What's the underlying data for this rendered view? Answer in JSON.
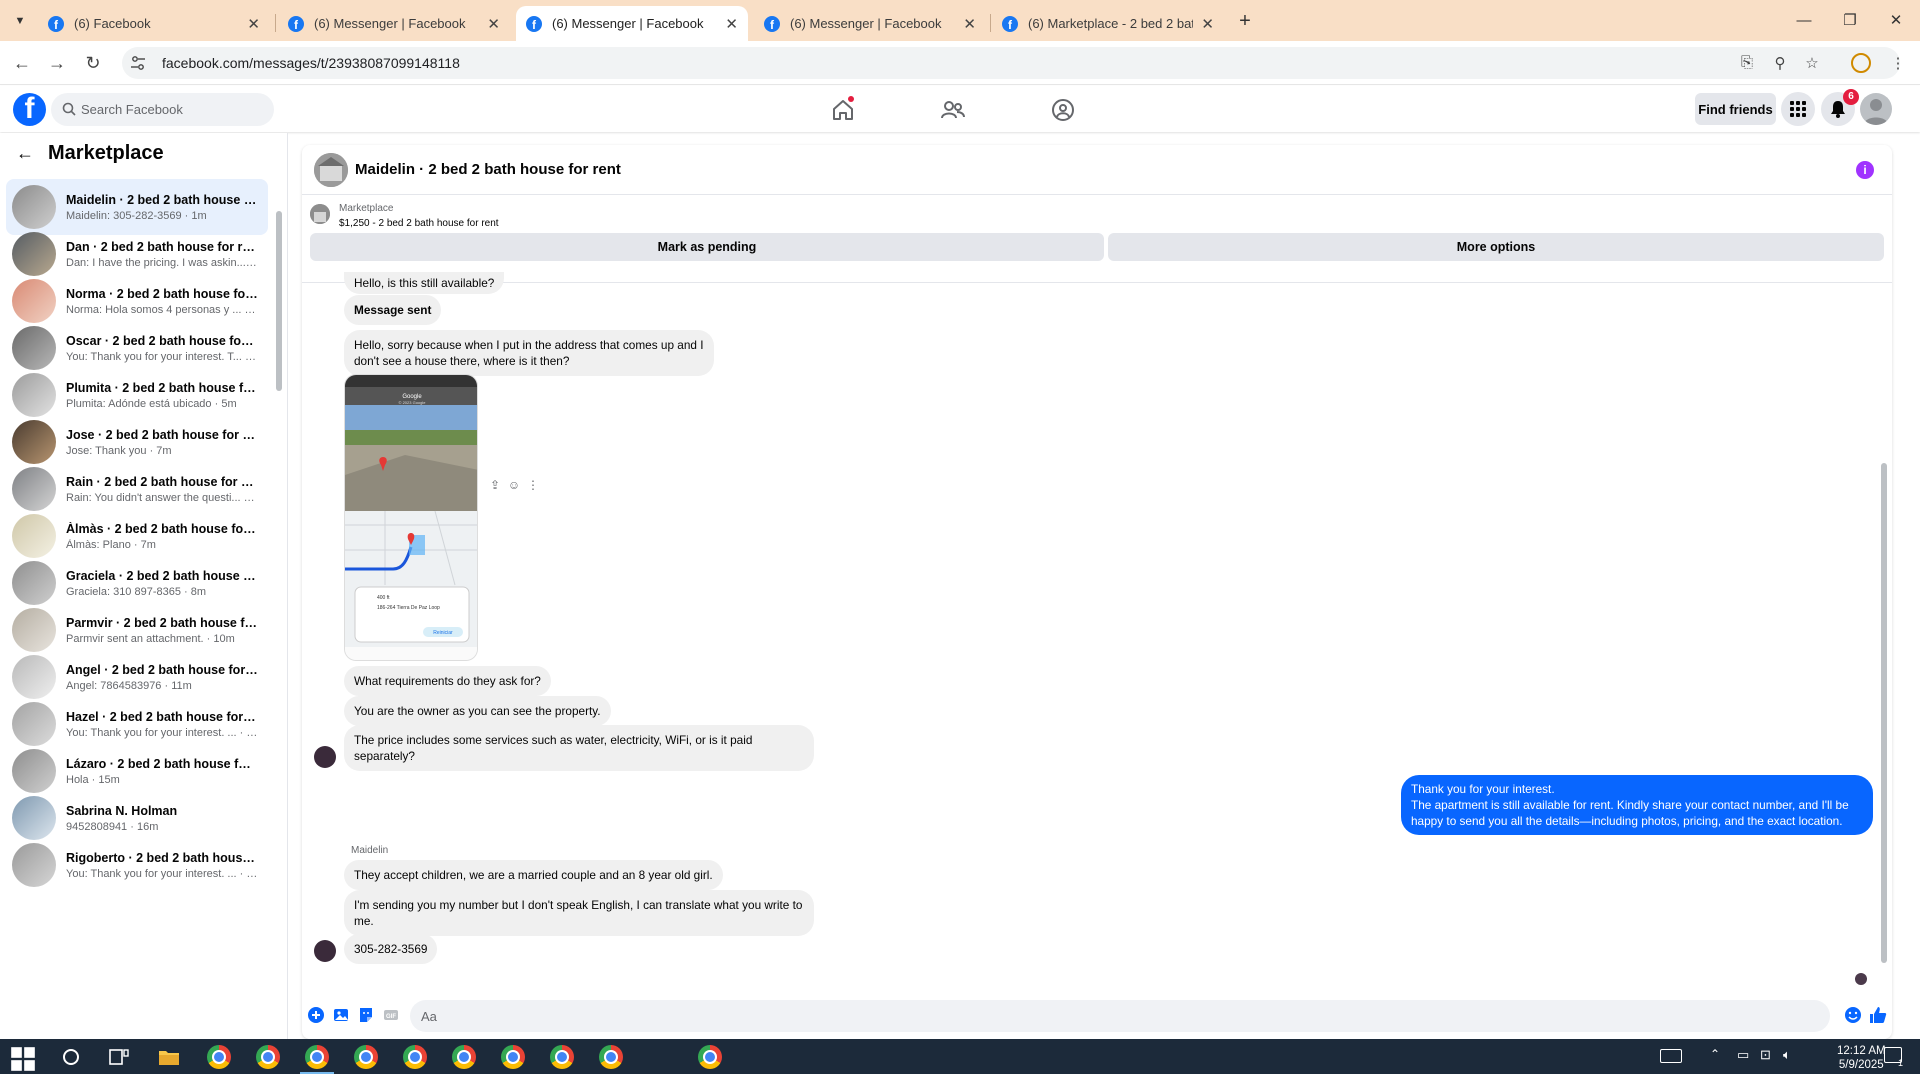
{
  "browser": {
    "tabs": [
      {
        "title": "(6) Facebook",
        "active": false
      },
      {
        "title": "(6) Messenger | Facebook",
        "active": false
      },
      {
        "title": "(6) Messenger | Facebook",
        "active": true
      },
      {
        "title": "(6) Messenger | Facebook",
        "active": false
      },
      {
        "title": "(6) Marketplace - 2 bed 2 bath h",
        "active": false
      }
    ],
    "url": "facebook.com/messages/t/23938087099148118"
  },
  "fb": {
    "search_placeholder": "Search Facebook",
    "find_friends_label": "Find friends",
    "notification_count": "6",
    "accent": "#0866ff"
  },
  "sidebar": {
    "title": "Marketplace",
    "conversations": [
      {
        "name": "Maidelin · 2 bed 2 bath house f...",
        "preview": "Maidelin: 305-282-3569 · 1m",
        "active": true
      },
      {
        "name": "Dan · 2 bed 2 bath house for rent",
        "preview": "Dan: I have the pricing. I was askin... · 1m"
      },
      {
        "name": "Norma · 2 bed 2 bath house for...",
        "preview": "Norma: Hola somos 4 personas y ... · 2m"
      },
      {
        "name": "Oscar · 2 bed 2 bath house for r...",
        "preview": "You: Thank you for your interest. T... · 2m"
      },
      {
        "name": "Plumita · 2 bed 2 bath house fo...",
        "preview": "Plumita: Adónde está ubicado · 5m"
      },
      {
        "name": "Jose · 2 bed 2 bath house for rent",
        "preview": "Jose: Thank you · 7m"
      },
      {
        "name": "Rain · 2 bed 2 bath house for rent",
        "preview": "Rain: You didn't answer the questi... · 7m"
      },
      {
        "name": "Àlmàs · 2 bed 2 bath house for ...",
        "preview": "Àlmàs: Plano · 7m"
      },
      {
        "name": "Graciela · 2 bed 2 bath house fo...",
        "preview": "Graciela: 310 897-8365 · 8m"
      },
      {
        "name": "Parmvir · 2 bed 2 bath house fo...",
        "preview": "Parmvir sent an attachment. · 10m"
      },
      {
        "name": "Angel · 2 bed 2 bath house for r...",
        "preview": "Angel: 7864583976 · 11m"
      },
      {
        "name": "Hazel · 2 bed 2 bath house for r...",
        "preview": "You: Thank you for your interest. ... · 14m"
      },
      {
        "name": "Lázaro · 2 bed 2 bath house for ...",
        "preview": "Hola · 15m"
      },
      {
        "name": "Sabrina N. Holman",
        "preview": "9452808941 · 16m"
      },
      {
        "name": "Rigoberto · 2 bed 2 bath house ...",
        "preview": "You: Thank you for your interest. ... · 18m"
      }
    ]
  },
  "chat": {
    "title": "Maidelin · 2 bed 2 bath house for rent",
    "marketplace_label": "Marketplace",
    "listing": "$1,250 - 2 bed 2 bath house for rent",
    "mark_pending_label": "Mark as pending",
    "more_options_label": "More options",
    "sender_name": "Maidelin",
    "messages": {
      "m1": "Hello, is this still available?",
      "m2": "Message sent",
      "m3": "Hello, sorry because when I put in the address that comes up and I don't see a house there, where is it then?",
      "m4": "What requirements do they ask for?",
      "m5": "You are the owner as you can see the property.",
      "m6": "The price includes some services such as water, electricity, WiFi, or is it paid separately?",
      "me1_line1": "Thank you for your interest.",
      "me1_line2": "The apartment is still available for rent. Kindly share your contact number, and I'll be happy to send you all the details—including photos, pricing, and the exact location.",
      "m7": "They accept children, we are a married couple and an 8 year old girl.",
      "m8": "I'm sending you my number but I don't speak English, I can translate what you write to me.",
      "m9": "305-282-3569"
    },
    "image_texts": {
      "header": "Google",
      "sub": "© 2023 Google",
      "card_line1": "400 ft",
      "card_line2": "186-264 Tierra De Paz Loop",
      "card_btn": "Reiniciar"
    },
    "composer_placeholder": "Aa"
  },
  "taskbar": {
    "time": "12:12 AM",
    "date": "5/9/2025",
    "notif_count": "1"
  }
}
